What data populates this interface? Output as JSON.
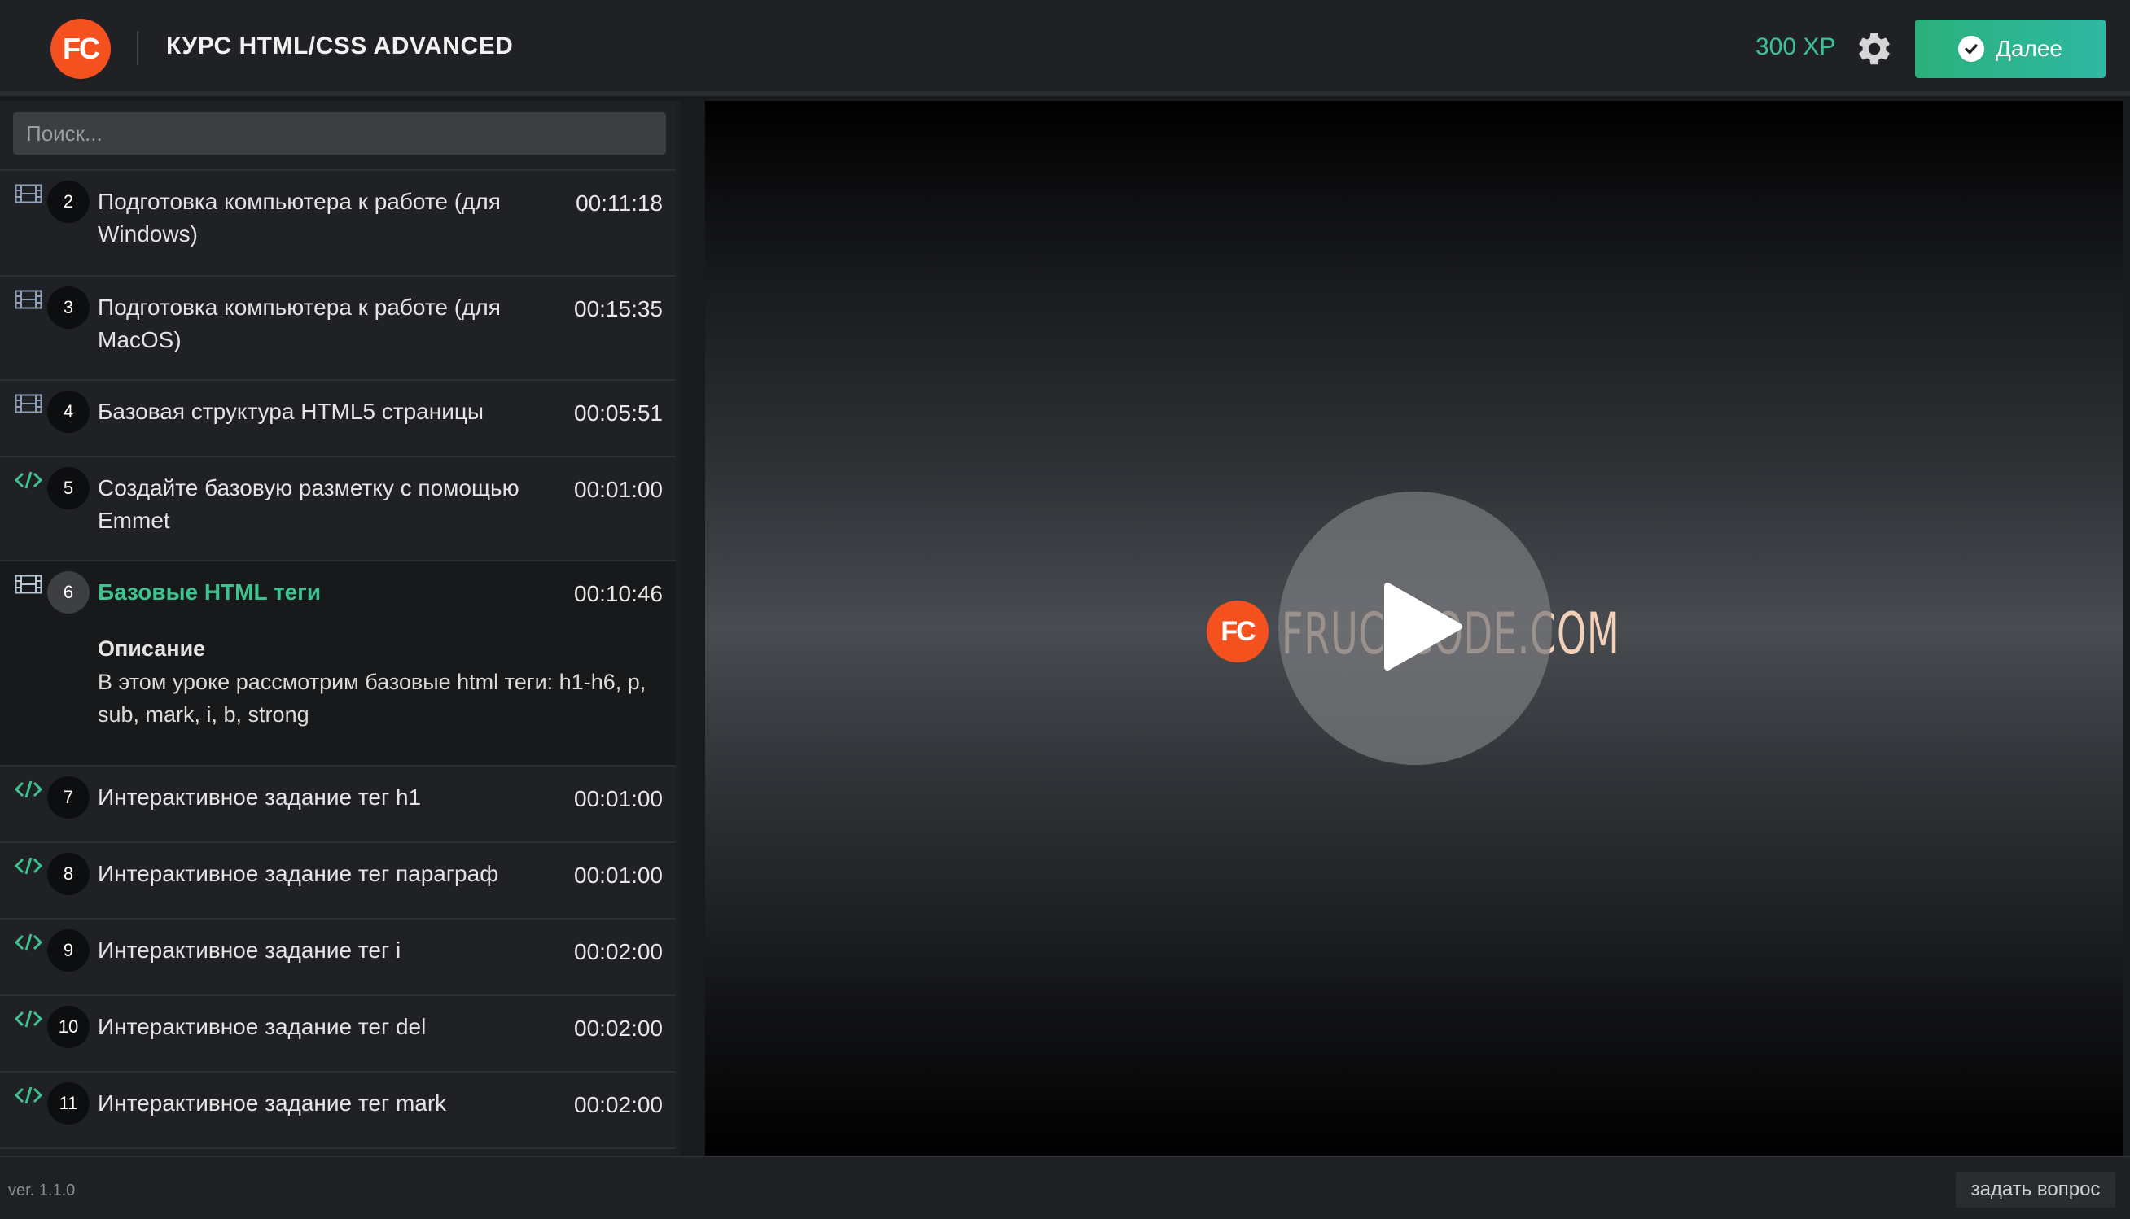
{
  "header": {
    "logo_text": "FC",
    "course_title": "КУРС HTML/CSS ADVANCED",
    "xp": "300 XP",
    "next_label": "Далее"
  },
  "sidebar": {
    "search_placeholder": "Поиск...",
    "items": [
      {
        "num": "2",
        "type": "video",
        "title": "Подготовка компьютера к работе (для Windows)",
        "duration": "00:11:18"
      },
      {
        "num": "3",
        "type": "video",
        "title": "Подготовка компьютера к работе (для MacOS)",
        "duration": "00:15:35"
      },
      {
        "num": "4",
        "type": "video",
        "title": "Базовая структура HTML5 страницы",
        "duration": "00:05:51"
      },
      {
        "num": "5",
        "type": "code",
        "title": "Создайте базовую разметку с помощью Emmet",
        "duration": "00:01:00"
      },
      {
        "num": "6",
        "type": "video",
        "title": "Базовые HTML теги",
        "duration": "00:10:46",
        "active": true,
        "description_heading": "Описание",
        "description": "В этом уроке рассмотрим базовые html теги: h1-h6, p, sub, mark, i, b, strong"
      },
      {
        "num": "7",
        "type": "code",
        "title": "Интерактивное задание тег h1",
        "duration": "00:01:00"
      },
      {
        "num": "8",
        "type": "code",
        "title": "Интерактивное задание тег параграф",
        "duration": "00:01:00"
      },
      {
        "num": "9",
        "type": "code",
        "title": "Интерактивное задание тег i",
        "duration": "00:02:00"
      },
      {
        "num": "10",
        "type": "code",
        "title": "Интерактивное задание тег del",
        "duration": "00:02:00"
      },
      {
        "num": "11",
        "type": "code",
        "title": "Интерактивное задание тег mark",
        "duration": "00:02:00"
      }
    ]
  },
  "video": {
    "brand_logo": "FC",
    "brand_text": "FRUCTCODE.COM"
  },
  "footer": {
    "version": "ver. 1.1.0",
    "ask_label": "задать вопрос"
  },
  "colors": {
    "accent_green": "#38c29a",
    "brand_orange": "#f4511e"
  },
  "icons": {
    "video": "film-icon",
    "code": "code-icon",
    "settings": "gear-icon",
    "next": "check-circle-icon",
    "play": "play-icon"
  }
}
